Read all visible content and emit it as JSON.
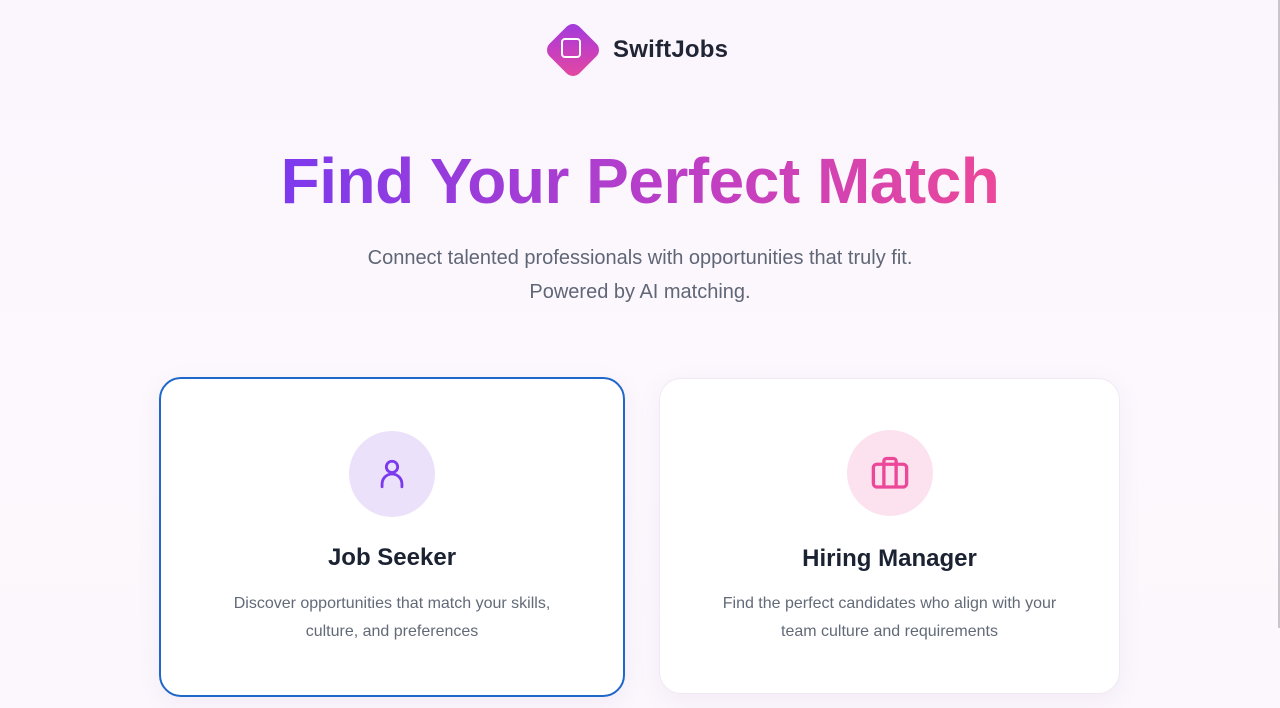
{
  "brand": {
    "name": "SwiftJobs",
    "logo_icon": "rounded-square-icon"
  },
  "hero": {
    "title": "Find Your Perfect Match",
    "subtitle_line1": "Connect talented professionals with opportunities that truly fit.",
    "subtitle_line2": "Powered by AI matching."
  },
  "roles": [
    {
      "title": "Job Seeker",
      "description_line1": "Discover opportunities that match your skills,",
      "description_line2": "culture, and preferences",
      "icon": "user-icon",
      "accent": "#7c3aed",
      "selected": true
    },
    {
      "title": "Hiring Manager",
      "description_line1": "Find the perfect candidates who align with your",
      "description_line2": "team culture and requirements",
      "icon": "briefcase-icon",
      "accent": "#ec4899",
      "selected": false
    }
  ],
  "colors": {
    "gradient_start": "#7c3aed",
    "gradient_end": "#ec4899",
    "selected_border": "#1f68c9"
  }
}
